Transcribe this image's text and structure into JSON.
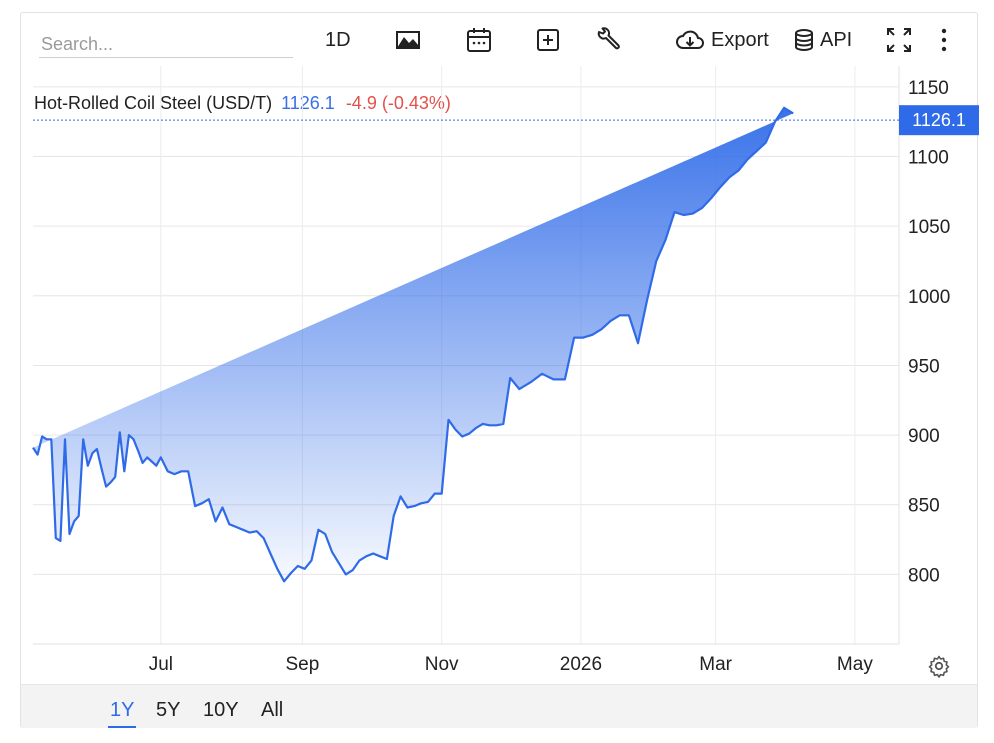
{
  "toolbar": {
    "search_placeholder": "Search...",
    "interval_label": "1D",
    "export_label": "Export",
    "api_label": "API"
  },
  "legend": {
    "name": "Hot-Rolled Coil Steel (USD/T)",
    "last": "1126.1",
    "change": "-4.9 (-0.43%)"
  },
  "price_tag": "1126.1",
  "ranges": [
    "1Y",
    "5Y",
    "10Y",
    "All"
  ],
  "active_range": "1Y",
  "colors": {
    "line": "#2f6be8",
    "up_fill": "#2f6be8",
    "change_negative": "#e2514c",
    "tag_bg": "#2f6be8"
  },
  "chart_data": {
    "type": "area",
    "title": "Hot-Rolled Coil Steel (USD/T)",
    "x_tick_labels": [
      "Jul",
      "Sep",
      "Nov",
      "2026",
      "Mar",
      "May"
    ],
    "y_tick_labels": [
      "800",
      "850",
      "900",
      "950",
      "1000",
      "1050",
      "1100",
      "1150"
    ],
    "ylim": [
      750,
      1165
    ],
    "xlim": [
      "2025-05-06",
      "2026-05-12"
    ],
    "grid": true,
    "last_value": 1126.1,
    "x": [
      "2025-05-06",
      "2025-05-08",
      "2025-05-10",
      "2025-05-12",
      "2025-05-14",
      "2025-05-16",
      "2025-05-18",
      "2025-05-20",
      "2025-05-22",
      "2025-05-24",
      "2025-05-26",
      "2025-05-28",
      "2025-05-30",
      "2025-06-01",
      "2025-06-03",
      "2025-06-05",
      "2025-06-07",
      "2025-06-09",
      "2025-06-11",
      "2025-06-13",
      "2025-06-15",
      "2025-06-17",
      "2025-06-19",
      "2025-06-21",
      "2025-06-23",
      "2025-06-25",
      "2025-06-27",
      "2025-06-29",
      "2025-07-01",
      "2025-07-04",
      "2025-07-07",
      "2025-07-10",
      "2025-07-13",
      "2025-07-16",
      "2025-07-19",
      "2025-07-22",
      "2025-07-25",
      "2025-07-28",
      "2025-07-31",
      "2025-08-03",
      "2025-08-06",
      "2025-08-09",
      "2025-08-12",
      "2025-08-15",
      "2025-08-18",
      "2025-08-21",
      "2025-08-24",
      "2025-08-27",
      "2025-08-30",
      "2025-09-02",
      "2025-09-05",
      "2025-09-08",
      "2025-09-11",
      "2025-09-14",
      "2025-09-17",
      "2025-09-20",
      "2025-09-23",
      "2025-09-26",
      "2025-09-29",
      "2025-10-02",
      "2025-10-05",
      "2025-10-08",
      "2025-10-11",
      "2025-10-14",
      "2025-10-17",
      "2025-10-20",
      "2025-10-23",
      "2025-10-26",
      "2025-10-29",
      "2025-11-01",
      "2025-11-04",
      "2025-11-07",
      "2025-11-10",
      "2025-11-13",
      "2025-11-16",
      "2025-11-19",
      "2025-11-22",
      "2025-11-25",
      "2025-11-28",
      "2025-12-01",
      "2025-12-05",
      "2025-12-10",
      "2025-12-15",
      "2025-12-20",
      "2025-12-25",
      "2025-12-29",
      "2026-01-02",
      "2026-01-06",
      "2026-01-10",
      "2026-01-14",
      "2026-01-18",
      "2026-01-22",
      "2026-01-26",
      "2026-01-30",
      "2026-02-03",
      "2026-02-07",
      "2026-02-11",
      "2026-02-15",
      "2026-02-19",
      "2026-02-23",
      "2026-02-27",
      "2026-03-03",
      "2026-03-07",
      "2026-03-11",
      "2026-03-15",
      "2026-03-19",
      "2026-03-23",
      "2026-03-27",
      "2026-03-31",
      "2026-04-04",
      "2026-04-08",
      "2026-04-12",
      "2026-04-16",
      "2026-04-20",
      "2026-04-24",
      "2026-04-28",
      "2026-05-02",
      "2026-05-05",
      "2026-05-08",
      "2026-05-11"
    ],
    "values": [
      891,
      886,
      899,
      897,
      897,
      826,
      824,
      897,
      829,
      838,
      842,
      897,
      878,
      887,
      890,
      876,
      863,
      866,
      870,
      902,
      874,
      900,
      897,
      889,
      880,
      884,
      881,
      878,
      884,
      874,
      872,
      874,
      874,
      849,
      851,
      854,
      838,
      848,
      836,
      834,
      832,
      830,
      831,
      826,
      815,
      804,
      795,
      801,
      806,
      804,
      810,
      832,
      829,
      816,
      808,
      800,
      803,
      810,
      813,
      815,
      813,
      811,
      842,
      856,
      848,
      849,
      851,
      852,
      858,
      858,
      911,
      904,
      899,
      901,
      905,
      908,
      907,
      907,
      908,
      941,
      933,
      938,
      944,
      940,
      940,
      970,
      970,
      972,
      976,
      982,
      986,
      986,
      966,
      997,
      1025,
      1040,
      1060,
      1058,
      1059,
      1063,
      1070,
      1078,
      1085,
      1090,
      1098,
      1104,
      1110,
      1125,
      1135,
      1131
    ]
  }
}
